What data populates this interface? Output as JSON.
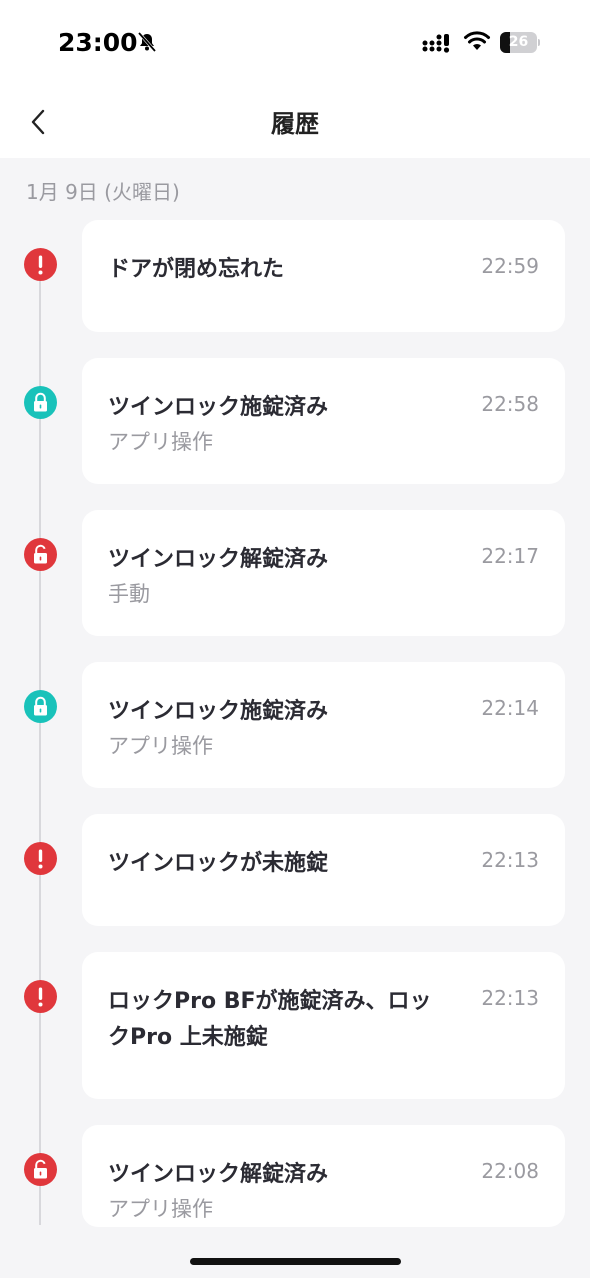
{
  "status_bar": {
    "time": "23:00",
    "battery_level": "26",
    "battery_fraction": 0.26
  },
  "nav": {
    "title": "履歴"
  },
  "date_header": "1月 9日 (火曜日)",
  "colors": {
    "alert": "#e0373c",
    "locked": "#19c2ba",
    "unlocked": "#e0373c"
  },
  "events": [
    {
      "icon": "alert-icon",
      "title": "ドアが閉め忘れた",
      "subtitle": "",
      "time": "22:59"
    },
    {
      "icon": "lock-closed-icon",
      "title": "ツインロック施錠済み",
      "subtitle": "アプリ操作",
      "time": "22:58"
    },
    {
      "icon": "lock-open-icon",
      "title": "ツインロック解錠済み",
      "subtitle": "手動",
      "time": "22:17"
    },
    {
      "icon": "lock-closed-icon",
      "title": "ツインロック施錠済み",
      "subtitle": "アプリ操作",
      "time": "22:14"
    },
    {
      "icon": "alert-icon",
      "title": "ツインロックが未施錠",
      "subtitle": "",
      "time": "22:13"
    },
    {
      "icon": "alert-icon",
      "title": "ロックPro BFが施錠済み、ロックPro 上未施錠",
      "subtitle": "",
      "time": "22:13"
    },
    {
      "icon": "lock-open-icon",
      "title": "ツインロック解錠済み",
      "subtitle": "アプリ操作",
      "time": "22:08"
    }
  ]
}
